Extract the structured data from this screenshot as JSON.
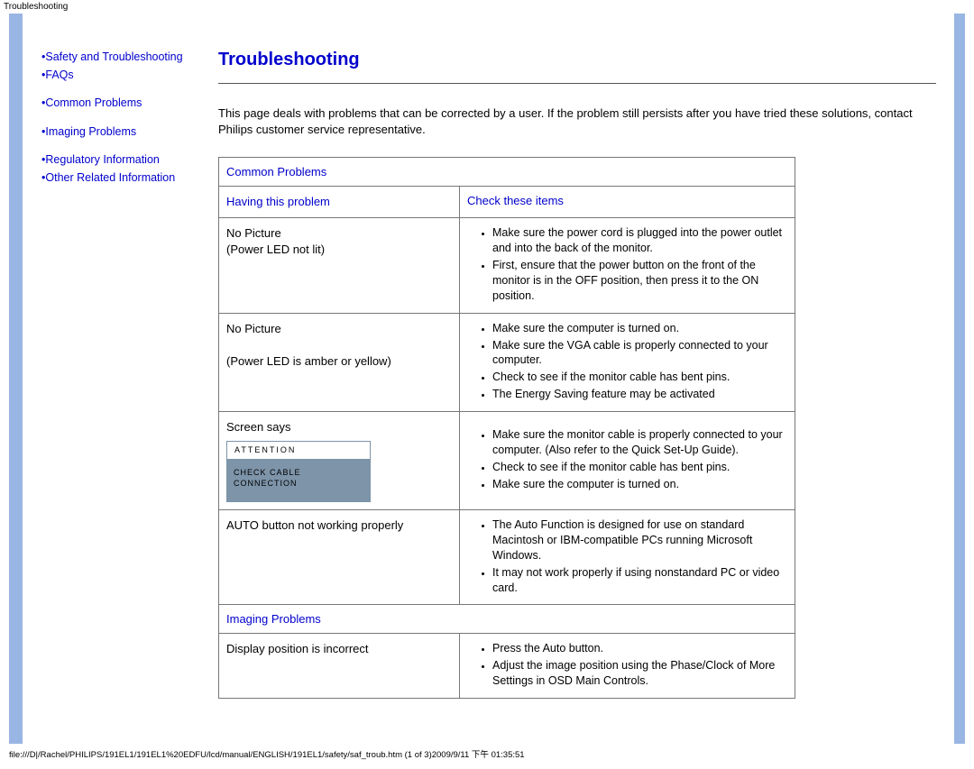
{
  "top_title": "Troubleshooting",
  "sidebar": {
    "nav": [
      {
        "label": "Safety and Troubleshooting"
      },
      {
        "label": "FAQs"
      },
      {
        "label": "Common Problems"
      },
      {
        "label": "Imaging Problems"
      },
      {
        "label": "Regulatory Information"
      },
      {
        "label": "Other Related Information"
      }
    ]
  },
  "main": {
    "heading": "Troubleshooting",
    "intro": "This page deals with problems that can be corrected by a user. If the problem still persists after you have tried these solutions, contact Philips customer service representative.",
    "sections": {
      "common": "Common Problems",
      "imaging": "Imaging Problems"
    },
    "col_headers": {
      "left": "Having this problem",
      "right": "Check these items"
    },
    "rows": {
      "r1": {
        "problem_l1": "No Picture",
        "problem_l2": "(Power LED not lit)",
        "checks": [
          "Make sure the power cord is plugged into the power outlet and into the back of the monitor.",
          "First, ensure that the power button on the front of the monitor is in the OFF position, then press it to the ON position."
        ]
      },
      "r2": {
        "problem_l1": "No Picture",
        "problem_l2": "(Power LED is amber or yellow)",
        "checks": [
          "Make sure the computer is turned on.",
          "Make sure the VGA cable is properly connected to your computer.",
          "Check to see if the monitor cable has bent pins.",
          "The Energy Saving feature may be activated"
        ]
      },
      "r3": {
        "problem_l1": "Screen says",
        "attention_label": "ATTENTION",
        "attention_msg": "CHECK CABLE CONNECTION",
        "checks": [
          "Make sure the monitor cable is properly connected to your computer. (Also refer to the Quick Set-Up Guide).",
          "Check to see if the monitor cable has bent pins.",
          "Make sure the computer is turned on."
        ]
      },
      "r4": {
        "problem_l1": "AUTO button not working properly",
        "checks": [
          "The Auto Function is designed for use on standard Macintosh or IBM-compatible PCs running Microsoft Windows.",
          "It may not work properly if using nonstandard PC or video card."
        ]
      },
      "r5": {
        "problem_l1": "Display position is incorrect",
        "checks": [
          "Press the Auto button.",
          "Adjust the image position using the Phase/Clock of More Settings in OSD Main Controls."
        ]
      }
    }
  },
  "footer_path": "file:///D|/Rachel/PHILIPS/191EL1/191EL1%20EDFU/lcd/manual/ENGLISH/191EL1/safety/saf_troub.htm (1 of 3)2009/9/11 下午 01:35:51"
}
